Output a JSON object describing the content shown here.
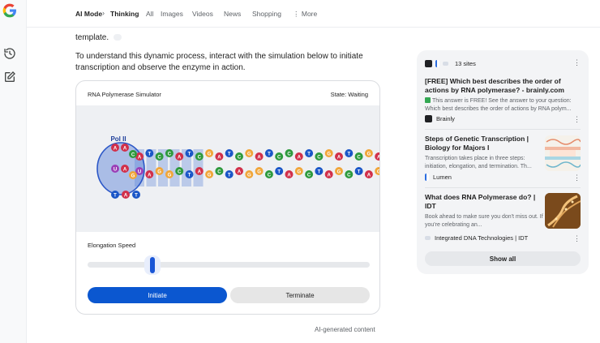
{
  "tabs": [
    {
      "label": "AI Mode"
    },
    {
      "label": "Thinking"
    },
    {
      "label": "All"
    },
    {
      "label": "Images"
    },
    {
      "label": "Videos"
    },
    {
      "label": "News"
    },
    {
      "label": "Shopping"
    },
    {
      "label": "More"
    }
  ],
  "tab_separator": "›",
  "main": {
    "partial_text": "template.",
    "paragraph": "To understand this dynamic process, interact with the simulation below to initiate transcription and observe the enzyme in action."
  },
  "simulator": {
    "title": "RNA Polymerase Simulator",
    "state": "State: Waiting",
    "polymerase_label": "Pol II",
    "speed_label": "Elongation Speed",
    "speed_level": 0.23,
    "initiate_label": "Initiate",
    "terminate_label": "Terminate",
    "top_strand": [
      "A",
      "T",
      "C",
      "C",
      "A",
      "T",
      "C",
      "G",
      "A",
      "T",
      "C",
      "G",
      "A",
      "T",
      "C",
      "C",
      "A",
      "T",
      "C",
      "G",
      "A",
      "T",
      "C",
      "G",
      "A",
      "T",
      "C",
      "C"
    ],
    "bottom_strand": [
      "U",
      "A",
      "G",
      "G",
      "C",
      "T",
      "A",
      "G",
      "C",
      "T",
      "A",
      "G",
      "G",
      "C",
      "T",
      "A",
      "G",
      "C",
      "T",
      "A",
      "G",
      "C",
      "T",
      "A",
      "G",
      "C",
      "T",
      "A"
    ],
    "template_fragment": [
      "T",
      "A",
      "T"
    ],
    "base_colors": {
      "A": "#d1304a",
      "T": "#1a56c7",
      "C": "#2e9a3d",
      "G": "#f0a63a",
      "U": "#9b3fb6"
    }
  },
  "ai_note": "AI-generated content",
  "sources": {
    "count_label": "13 sites",
    "items": [
      {
        "title": "[FREE] Which best describes the order of actions by RNA polymerase? - brainly.com",
        "snippet": "This answer is FREE! See the answer to your question: Which best describes the order of actions by RNA polym...",
        "site": "Brainly"
      },
      {
        "title": "Steps of Genetic Transcription | Biology for Majors I",
        "snippet": "Transcription takes place in three steps: initiation, elongation, and termination. Th...",
        "site": "Lumen"
      },
      {
        "title": "What does RNA Polymerase do? | IDT",
        "snippet": "Book ahead to make sure you don't miss out. If you're celebrating an...",
        "site": "Integrated DNA Technologies | IDT"
      }
    ],
    "show_all_label": "Show all"
  },
  "colors": {
    "accent": "#0b57d0",
    "panel": "#f3f4f6",
    "stage": "#eef0f3"
  }
}
